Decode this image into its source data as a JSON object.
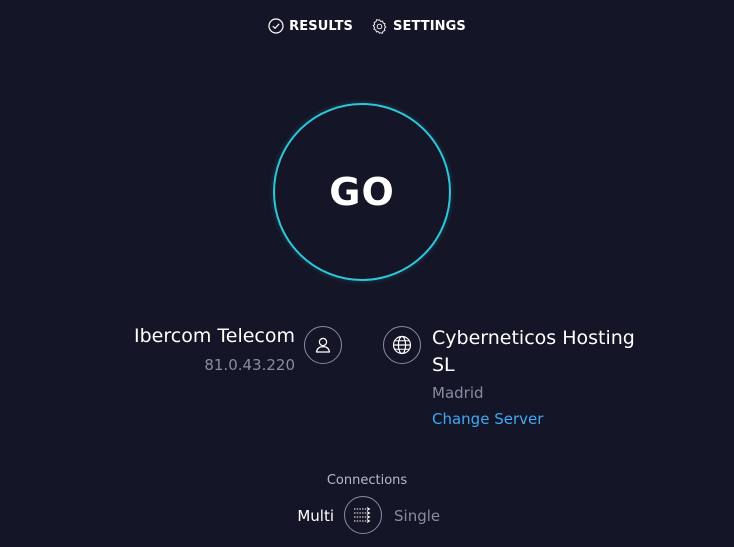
{
  "nav": {
    "results_label": "RESULTS",
    "settings_label": "SETTINGS"
  },
  "go": {
    "label": "GO"
  },
  "isp": {
    "name": "Ibercom Telecom",
    "ip": "81.0.43.220"
  },
  "server": {
    "name": "Cyberneticos Hosting SL",
    "location": "Madrid",
    "change_label": "Change Server"
  },
  "connections": {
    "label": "Connections",
    "multi_label": "Multi",
    "single_label": "Single",
    "selected": "Multi"
  },
  "icons": {
    "results": "check-circle-icon",
    "settings": "gear-icon",
    "isp": "user-icon",
    "server": "globe-icon",
    "connections": "connections-toggle-icon"
  },
  "colors": {
    "background": "#141526",
    "accent_ring": "#2ec6d9",
    "link": "#3fa9f5",
    "muted": "#8a8ba0"
  }
}
